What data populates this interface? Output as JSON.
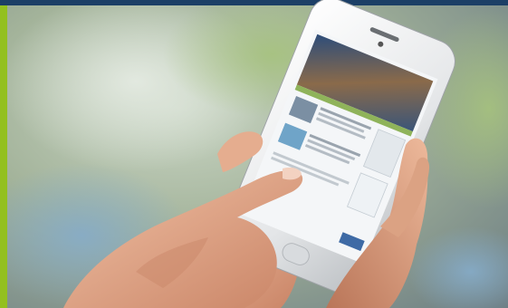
{
  "photo": {
    "subject": "hands-holding-smartphone",
    "colors": {
      "top_bar": "#1c3f66",
      "left_stripe": "#93c01f",
      "background_green": "#9cb680",
      "background_blue": "#7fa8c6",
      "phone_body": "#eeeeee",
      "screen_header": "#5a6f8a",
      "screen_accent": "#8fb35a",
      "skin": "#e3a88a"
    }
  }
}
